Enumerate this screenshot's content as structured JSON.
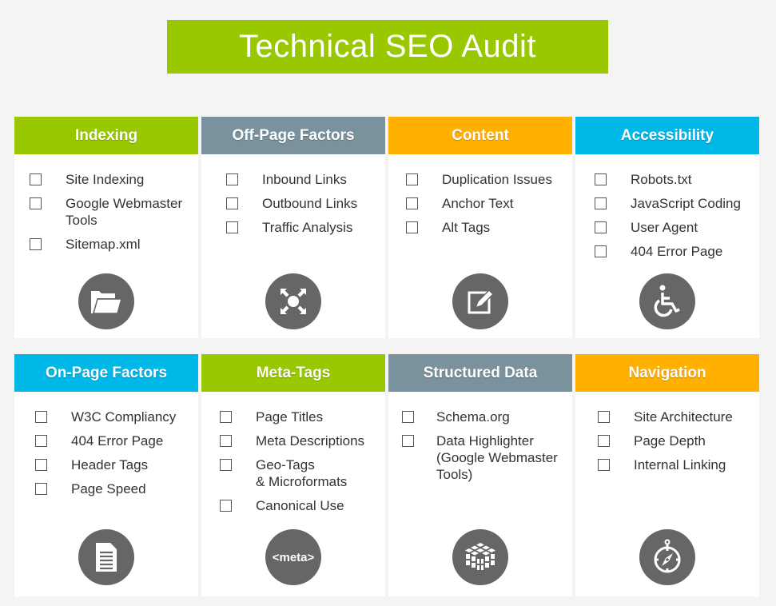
{
  "title": "Technical SEO Audit",
  "colors": {
    "green": "#99c800",
    "slate": "#7a929e",
    "orange": "#ffb000",
    "blue": "#00b8e8",
    "icon_bg": "#666666",
    "background": "#f4f4f4"
  },
  "cards": [
    {
      "title": "Indexing",
      "icon": "folder-open-icon",
      "items": [
        "Site Indexing",
        "Google Webmaster\nTools",
        "Sitemap.xml"
      ]
    },
    {
      "title": "Off-Page Factors",
      "icon": "compress-arrows-icon",
      "items": [
        "Inbound Links",
        "Outbound Links",
        "Traffic Analysis"
      ]
    },
    {
      "title": "Content",
      "icon": "edit-pencil-icon",
      "items": [
        "Duplication Issues",
        "Anchor Text",
        "Alt Tags"
      ]
    },
    {
      "title": "Accessibility",
      "icon": "wheelchair-icon",
      "items": [
        "Robots.txt",
        "JavaScript Coding",
        "User Agent",
        "404 Error Page"
      ]
    },
    {
      "title": "On-Page Factors",
      "icon": "document-list-icon",
      "items": [
        "W3C Compliancy",
        "404 Error Page",
        "Header Tags",
        "Page Speed"
      ]
    },
    {
      "title": "Meta-Tags",
      "icon": "meta-tag-icon",
      "icon_text": "<meta>",
      "items": [
        "Page Titles",
        "Meta Descriptions",
        "Geo-Tags\n& Microformats",
        "Canonical Use"
      ]
    },
    {
      "title": "Structured Data",
      "icon": "cube-grid-icon",
      "items": [
        "Schema.org",
        "Data Highlighter\n(Google Webmaster\nTools)"
      ]
    },
    {
      "title": "Navigation",
      "icon": "compass-icon",
      "items": [
        "Site Architecture",
        "Page Depth",
        "Internal Linking"
      ]
    }
  ]
}
